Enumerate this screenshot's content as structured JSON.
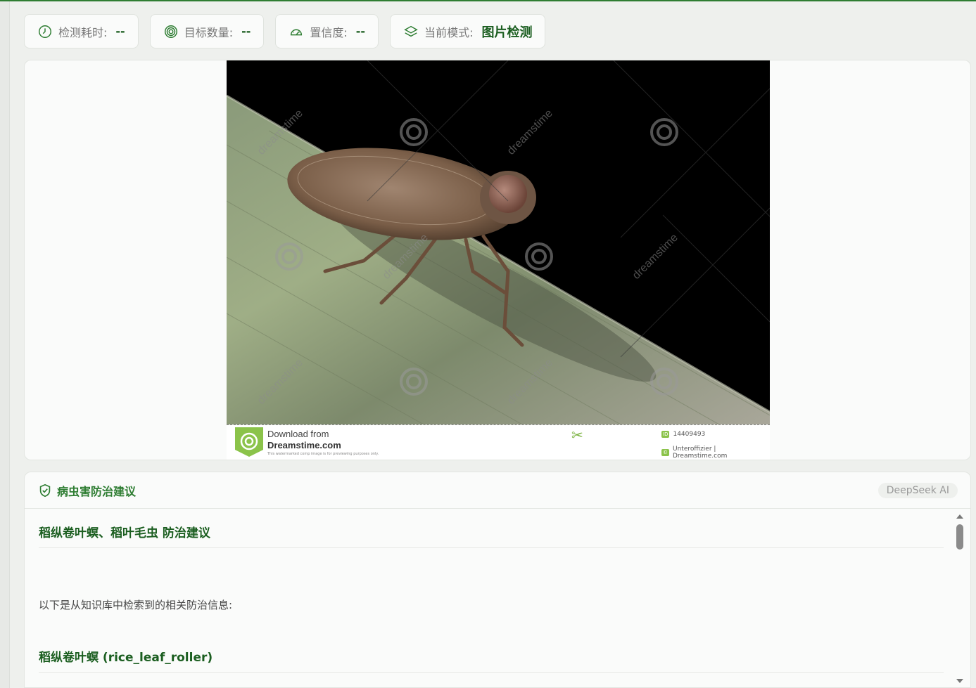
{
  "stats": {
    "time": {
      "label": "检测耗时:",
      "value": "--",
      "icon": "clock-icon"
    },
    "count": {
      "label": "目标数量:",
      "value": "--",
      "icon": "target-icon"
    },
    "confidence": {
      "label": "置信度:",
      "value": "--",
      "icon": "gauge-icon"
    },
    "mode": {
      "label": "当前模式:",
      "value": "图片检测",
      "icon": "layers-icon"
    }
  },
  "image": {
    "watermark_text": "dreamstime",
    "credit": {
      "download_from": "Download from",
      "site": "Dreamstime.com",
      "disclaimer": "This watermarked comp image is for previewing purposes only.",
      "id_tag": "ID",
      "id_value": "14409493",
      "author": "Unteroffizier | Dreamstime.com"
    }
  },
  "advice": {
    "title": "病虫害防治建议",
    "badge": "DeepSeek AI",
    "heading": "稻纵卷叶螟、稻叶毛虫 防治建议",
    "intro": "以下是从知识库中检索到的相关防治信息:",
    "subheading": "稻纵卷叶螟 (rice_leaf_roller)"
  },
  "colors": {
    "accent": "#2e7d32",
    "accent_dark": "#1b5e20",
    "background": "#eef0ed",
    "card": "#fafbfa"
  }
}
